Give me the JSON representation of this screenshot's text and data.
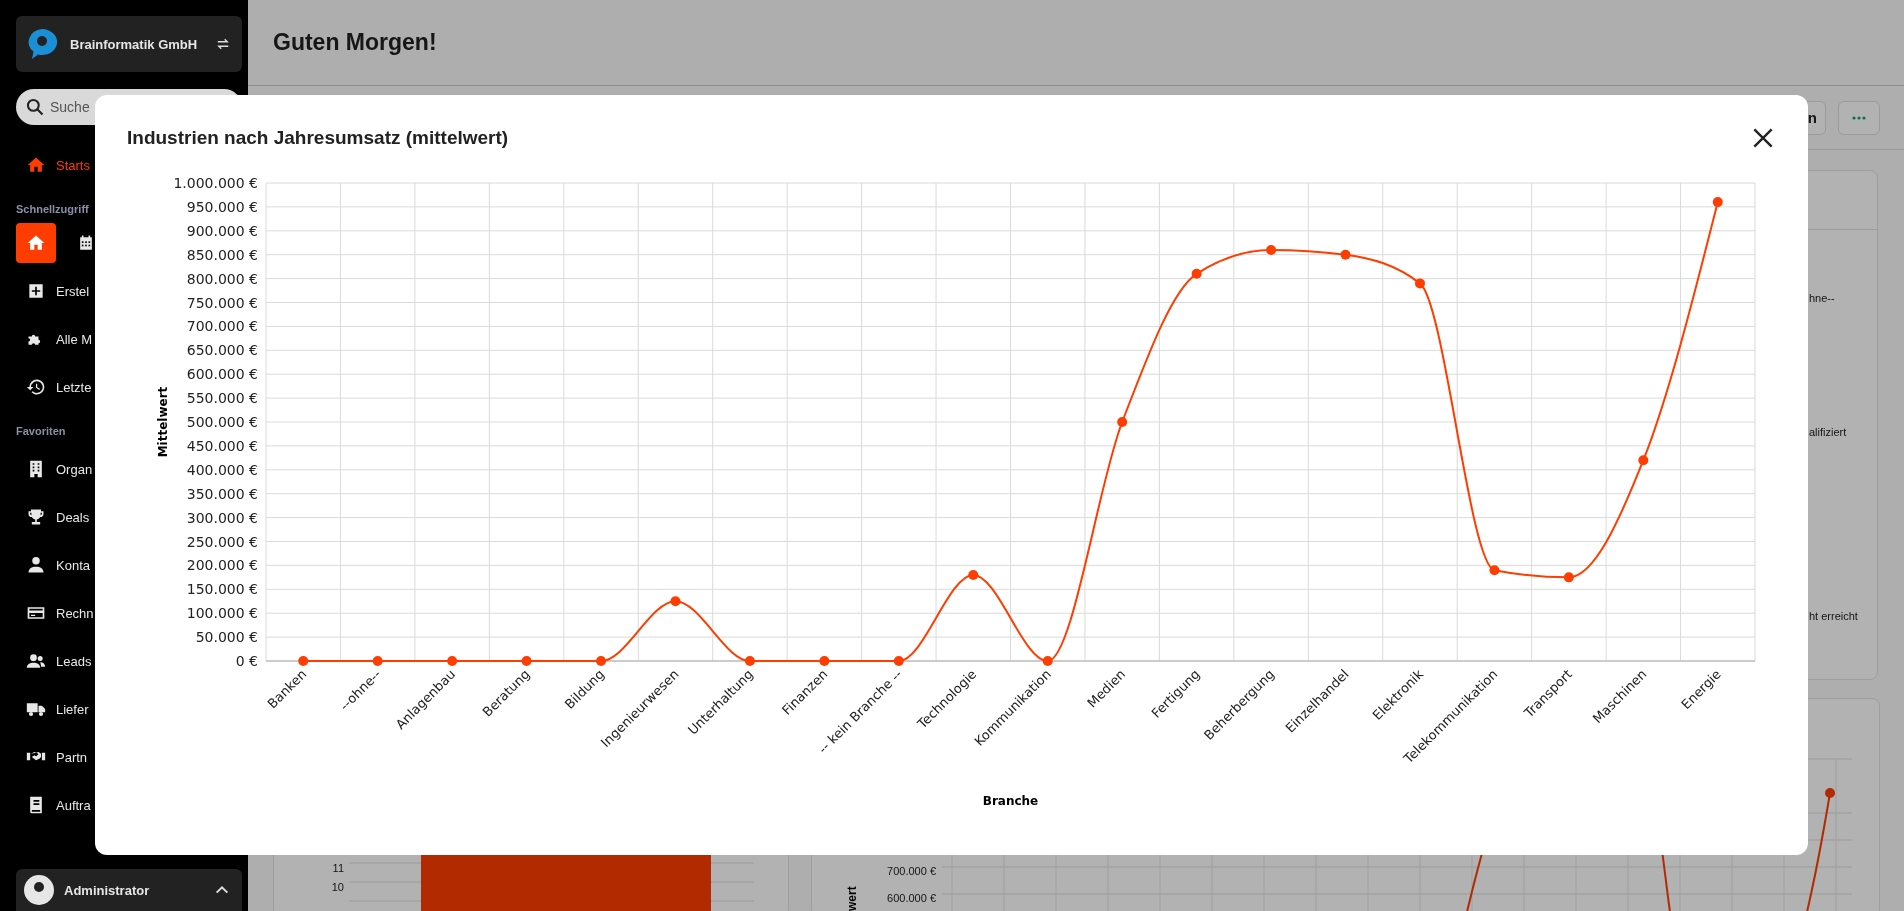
{
  "sidebar": {
    "company": "Brainformatik GmbH",
    "search": {
      "placeholder": "Suche"
    },
    "home": {
      "label": "Starts",
      "selected": true
    },
    "sections": [
      {
        "title": "Schnellzugriff",
        "quick": [
          {
            "selected": true
          },
          {
            "selected": false
          }
        ],
        "items": [
          {
            "label": "Erstel",
            "selected": false
          },
          {
            "label": "Alle M",
            "selected": false
          },
          {
            "label": "Letzte",
            "selected": false
          }
        ]
      },
      {
        "title": "Favoriten",
        "items": [
          {
            "label": "Organ",
            "selected": false
          },
          {
            "label": "Deals",
            "selected": false
          },
          {
            "label": "Konta",
            "selected": false
          },
          {
            "label": "Rechn",
            "selected": false
          },
          {
            "label": "Leads",
            "selected": false
          },
          {
            "label": "Liefer",
            "selected": false
          },
          {
            "label": "Partn",
            "selected": false
          },
          {
            "label": "Auftra",
            "selected": false
          }
        ]
      }
    ],
    "user": "Administrator"
  },
  "page": {
    "title": "Guten Morgen!",
    "toolbar_button": "n",
    "side_card_texts": [
      "hne--",
      "alifiziert",
      "ht erreicht"
    ],
    "bar_card_ticks": [
      "11",
      "10"
    ],
    "line_card_ticks": [
      "700.000 €",
      "600.000 €"
    ],
    "line_card_axis": "wert"
  },
  "modal": {
    "chart_data": {
      "type": "line",
      "title": "Industrien nach Jahresumsatz (mittelwert)",
      "xlabel": "Branche",
      "ylabel": "Mittelwert",
      "categories": [
        "Banken",
        "--ohne--",
        "Anlagenbau",
        "Beratung",
        "Bildung",
        "Ingenieurwesen",
        "Unterhaltung",
        "Finanzen",
        "-- kein Branche --",
        "Technologie",
        "Kommunikation",
        "Medien",
        "Fertigung",
        "Beherbergung",
        "Einzelhandel",
        "Elektronik",
        "Telekommunikation",
        "Transport",
        "Maschinen",
        "Energie"
      ],
      "grid": true,
      "series": [
        {
          "color": "#ff3d00",
          "marker": true,
          "values": [
            0,
            0,
            0,
            0,
            0,
            125000,
            0,
            0,
            0,
            180000,
            0,
            500000,
            810000,
            860000,
            850000,
            790000,
            190000,
            175000,
            420000,
            960000
          ]
        }
      ],
      "ylim": [
        0,
        1000000
      ],
      "yticks": [
        {
          "value": 0,
          "label": "0 €"
        },
        {
          "value": 50000,
          "label": "50.000 €"
        },
        {
          "value": 100000,
          "label": "100.000 €"
        },
        {
          "value": 150000,
          "label": "150.000 €"
        },
        {
          "value": 200000,
          "label": "200.000 €"
        },
        {
          "value": 250000,
          "label": "250.000 €"
        },
        {
          "value": 300000,
          "label": "300.000 €"
        },
        {
          "value": 350000,
          "label": "350.000 €"
        },
        {
          "value": 400000,
          "label": "400.000 €"
        },
        {
          "value": 450000,
          "label": "450.000 €"
        },
        {
          "value": 500000,
          "label": "500.000 €"
        },
        {
          "value": 550000,
          "label": "550.000 €"
        },
        {
          "value": 600000,
          "label": "600.000 €"
        },
        {
          "value": 650000,
          "label": "650.000 €"
        },
        {
          "value": 700000,
          "label": "700.000 €"
        },
        {
          "value": 750000,
          "label": "750.000 €"
        },
        {
          "value": 800000,
          "label": "800.000 €"
        },
        {
          "value": 850000,
          "label": "850.000 €"
        },
        {
          "value": 900000,
          "label": "900.000 €"
        },
        {
          "value": 950000,
          "label": "950.000 €"
        },
        {
          "value": 1000000,
          "label": "1.000.000 €"
        }
      ]
    }
  }
}
